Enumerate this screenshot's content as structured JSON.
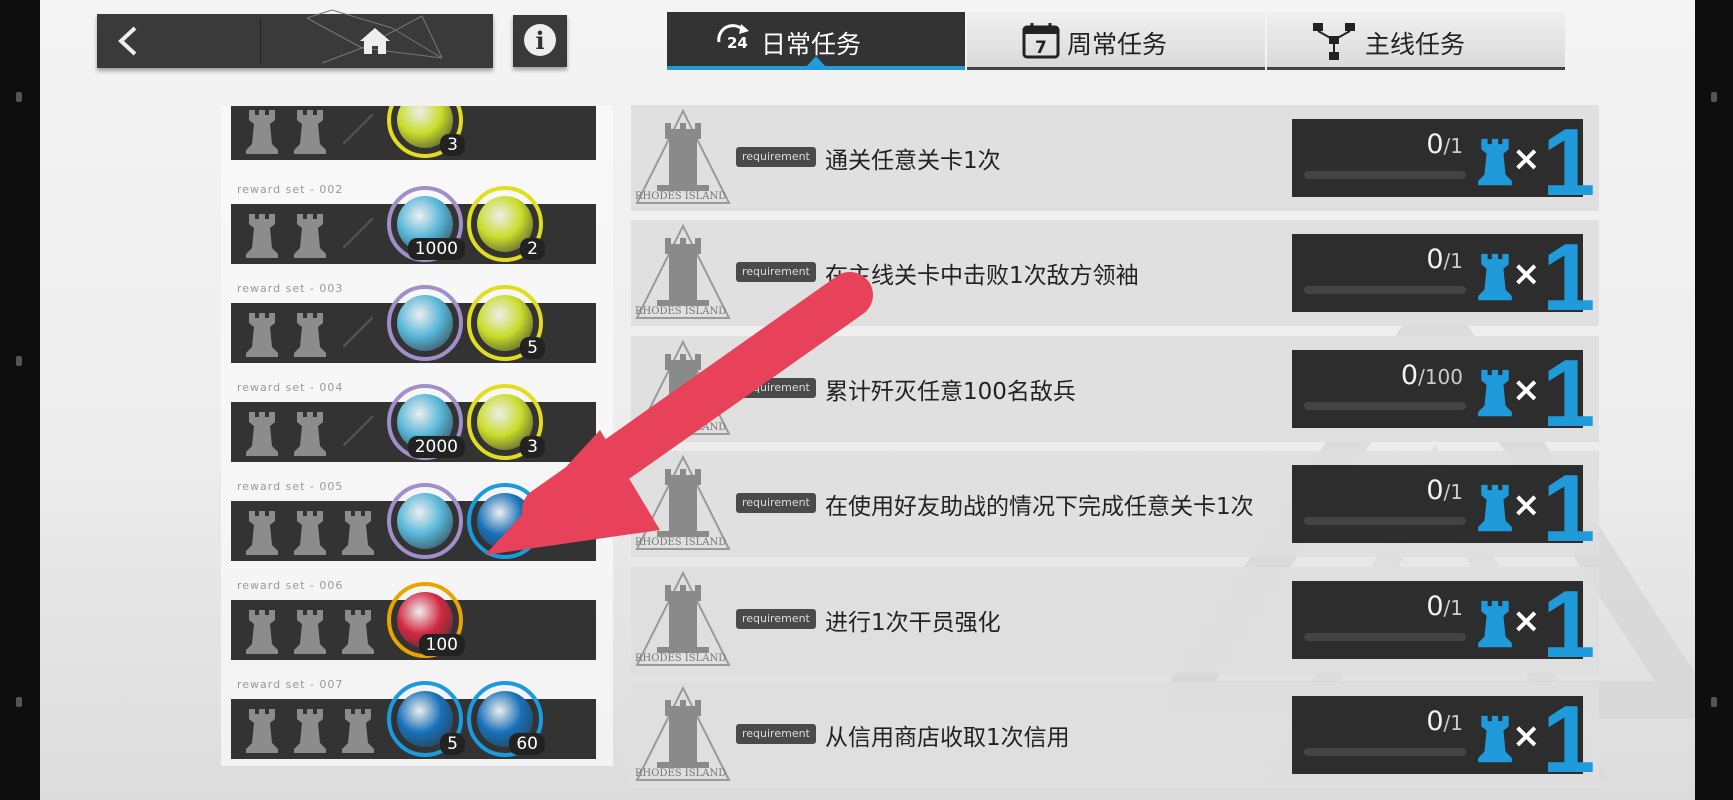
{
  "header": {
    "home_label": "",
    "info_label": "i"
  },
  "tabs": [
    {
      "label": "日常任务",
      "icon": "24h-refresh-icon",
      "active": true
    },
    {
      "label": "周常任务",
      "icon": "calendar-7-icon",
      "active": false
    },
    {
      "label": "主线任务",
      "icon": "hierarchy-icon",
      "active": false
    }
  ],
  "reward_sets": [
    {
      "label": "",
      "progress_slots": 2,
      "items": [
        {
          "kind": "yellow",
          "qty": "3"
        }
      ]
    },
    {
      "label": "reward set - 002",
      "progress_slots": 2,
      "items": [
        {
          "kind": "purple",
          "qty": "1000"
        },
        {
          "kind": "yellow",
          "qty": "2"
        }
      ]
    },
    {
      "label": "reward set - 003",
      "progress_slots": 2,
      "items": [
        {
          "kind": "purple",
          "qty": ""
        },
        {
          "kind": "yellow",
          "qty": "5"
        }
      ]
    },
    {
      "label": "reward set - 004",
      "progress_slots": 2,
      "items": [
        {
          "kind": "purple",
          "qty": "2000"
        },
        {
          "kind": "yellow",
          "qty": "3"
        }
      ]
    },
    {
      "label": "reward set - 005",
      "progress_slots": 3,
      "items": [
        {
          "kind": "purple",
          "qty": ""
        },
        {
          "kind": "blue",
          "qty": ""
        }
      ]
    },
    {
      "label": "reward set - 006",
      "progress_slots": 3,
      "items": [
        {
          "kind": "gold",
          "qty": "100"
        }
      ]
    },
    {
      "label": "reward set - 007",
      "progress_slots": 3,
      "items": [
        {
          "kind": "blue",
          "qty": "5"
        },
        {
          "kind": "blue",
          "qty": "60"
        }
      ]
    }
  ],
  "missions": [
    {
      "requirement_tag": "requirement",
      "text": "通关任意关卡1次",
      "progress": "0",
      "total": "/1",
      "reward_mult": "×",
      "reward_count": "1"
    },
    {
      "requirement_tag": "requirement",
      "text": "在主线关卡中击败1次敌方领袖",
      "progress": "0",
      "total": "/1",
      "reward_mult": "×",
      "reward_count": "1"
    },
    {
      "requirement_tag": "requirement",
      "text": "累计歼灭任意100名敌兵",
      "progress": "0",
      "total": "/100",
      "reward_mult": "×",
      "reward_count": "1"
    },
    {
      "requirement_tag": "requirement",
      "text": "在使用好友助战的情况下完成任意关卡1次",
      "progress": "0",
      "total": "/1",
      "reward_mult": "×",
      "reward_count": "1"
    },
    {
      "requirement_tag": "requirement",
      "text": "进行1次干员强化",
      "progress": "0",
      "total": "/1",
      "reward_mult": "×",
      "reward_count": "1"
    },
    {
      "requirement_tag": "requirement",
      "text": "从信用商店收取1次信用",
      "progress": "0",
      "total": "/1",
      "reward_mult": "×",
      "reward_count": "1"
    }
  ],
  "logo_text": "RHODES ISLAND",
  "colors": {
    "accent": "#1f9bdc",
    "arrow": "#e8425a",
    "panel_dark": "#333333"
  }
}
